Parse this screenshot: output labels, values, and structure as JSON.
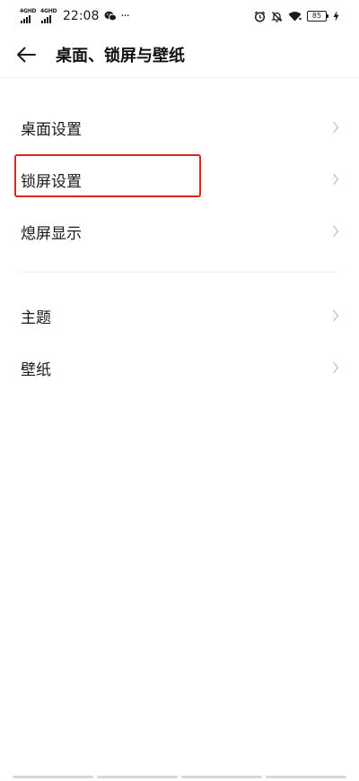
{
  "status_bar": {
    "network_1": "4GHD",
    "network_2": "4GHD",
    "time": "22:08",
    "more": "···",
    "battery": "85"
  },
  "header": {
    "title": "桌面、锁屏与壁纸"
  },
  "sections": [
    {
      "items": [
        {
          "label": "桌面设置"
        },
        {
          "label": "锁屏设置"
        },
        {
          "label": "熄屏显示"
        }
      ]
    },
    {
      "items": [
        {
          "label": "主题"
        },
        {
          "label": "壁纸"
        }
      ]
    }
  ],
  "colors": {
    "highlight": "#e1251b",
    "text": "#1a1a1a",
    "chevron": "#bdbdbd"
  },
  "icons": {
    "back": "arrow-left-icon",
    "chevron": "chevron-right-icon",
    "alarm": "alarm-icon",
    "mute": "bell-off-icon",
    "wifi": "wifi-icon",
    "battery": "battery-icon",
    "charging": "lightning-icon",
    "wechat": "wechat-icon"
  }
}
